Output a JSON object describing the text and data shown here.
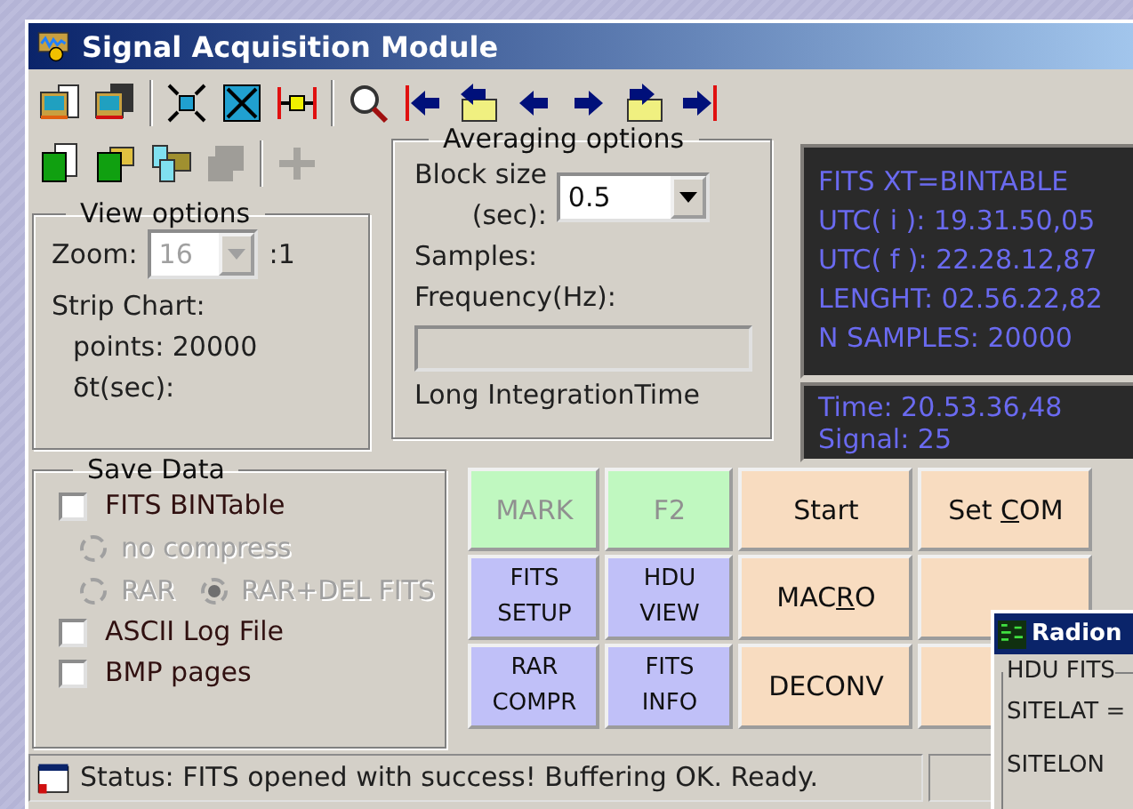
{
  "window": {
    "title": "Signal Acquisition Module"
  },
  "toolbar_rows": [
    {
      "items": [
        {
          "kind": "screen-doc",
          "disabled": false
        },
        {
          "kind": "screen-save",
          "disabled": false
        },
        {
          "kind": "separator"
        },
        {
          "kind": "fit",
          "disabled": false
        },
        {
          "kind": "shrink",
          "disabled": false
        },
        {
          "kind": "range",
          "disabled": false
        },
        {
          "kind": "separator"
        },
        {
          "kind": "magnifier",
          "disabled": false
        },
        {
          "kind": "first",
          "disabled": false
        },
        {
          "kind": "open-prev",
          "disabled": false
        },
        {
          "kind": "prev",
          "disabled": false
        },
        {
          "kind": "next",
          "disabled": false
        },
        {
          "kind": "open-next",
          "disabled": false
        },
        {
          "kind": "last",
          "disabled": false
        }
      ]
    },
    {
      "items": [
        {
          "kind": "grid-doc",
          "disabled": false
        },
        {
          "kind": "grid-folder",
          "disabled": false
        },
        {
          "kind": "files-folder",
          "disabled": false
        },
        {
          "kind": "blocks",
          "disabled": true
        },
        {
          "kind": "separator"
        },
        {
          "kind": "plus",
          "disabled": true
        }
      ]
    }
  ],
  "view_options": {
    "title": "View options",
    "zoom_label": "Zoom:",
    "zoom_value": "16",
    "zoom_disabled": true,
    "zoom_suffix": ":1",
    "strip_chart": "Strip Chart:",
    "points": "points: 20000",
    "dt": "δt(sec):"
  },
  "averaging": {
    "title": "Averaging options",
    "block_label_1": "Block size",
    "block_label_2": "(sec):",
    "block_value": "0.5",
    "samples": "Samples:",
    "frequency": "Frequency(Hz):",
    "long_integration": "Long IntegrationTime"
  },
  "fits_info": {
    "lines": [
      "FITS XT=BINTABLE",
      "UTC( i ): 19.31.50,05",
      "UTC( f ): 22.28.12,87",
      "LENGHT: 02.56.22,82",
      "N SAMPLES: 20000"
    ]
  },
  "live": {
    "lines": [
      "Time: 20.53.36,48",
      "Signal: 25"
    ]
  },
  "save_data": {
    "title": "Save Data",
    "rows": [
      {
        "kind": "checkbox",
        "label": "FITS BINTable",
        "checked": false
      },
      {
        "kind": "radios",
        "options": [
          {
            "label": "no compress",
            "selected": false,
            "disabled": true
          }
        ]
      },
      {
        "kind": "radios",
        "options": [
          {
            "label": "RAR",
            "selected": false,
            "disabled": true
          },
          {
            "label": "RAR+DEL FITS",
            "selected": true,
            "disabled": true
          }
        ]
      },
      {
        "kind": "checkbox",
        "label": "ASCII Log File",
        "checked": false
      },
      {
        "kind": "checkbox",
        "label": "BMP pages",
        "checked": false
      }
    ]
  },
  "buttons": [
    {
      "lines": [
        "MARK"
      ],
      "color": "#c0f8c0",
      "disabled": true
    },
    {
      "lines": [
        "F2"
      ],
      "color": "#c0f8c0",
      "disabled": true
    },
    {
      "lines": [
        "Start"
      ],
      "color": "#f8dcc0",
      "disabled": false
    },
    {
      "parts": {
        "before": "Set ",
        "key": "C",
        "after": "OM"
      },
      "color": "#f8dcc0",
      "disabled": false
    },
    {
      "lines": [
        "FITS",
        "SETUP"
      ],
      "color": "#c0c0f8",
      "disabled": false
    },
    {
      "lines": [
        "HDU",
        "VIEW"
      ],
      "color": "#c0c0f8",
      "disabled": false
    },
    {
      "parts": {
        "before": "MAC",
        "key": "R",
        "after": "O"
      },
      "color": "#f8dcc0",
      "disabled": false
    },
    {
      "color": "#f8dcc0"
    },
    {
      "lines": [
        "RAR",
        "COMPR"
      ],
      "color": "#c0c0f8",
      "disabled": false
    },
    {
      "lines": [
        "FITS",
        "INFO"
      ],
      "color": "#c0c0f8",
      "disabled": false
    },
    {
      "lines": [
        "DECONV"
      ],
      "color": "#f8dcc0",
      "disabled": false
    },
    {
      "color": "#f8dcc0"
    }
  ],
  "status_bar": {
    "text": "Status: FITS opened with success! Buffering OK. Ready."
  },
  "hdu_window": {
    "title": "Radion",
    "group": "HDU FITS",
    "lines": [
      "SITELAT =",
      "SITELON"
    ]
  }
}
